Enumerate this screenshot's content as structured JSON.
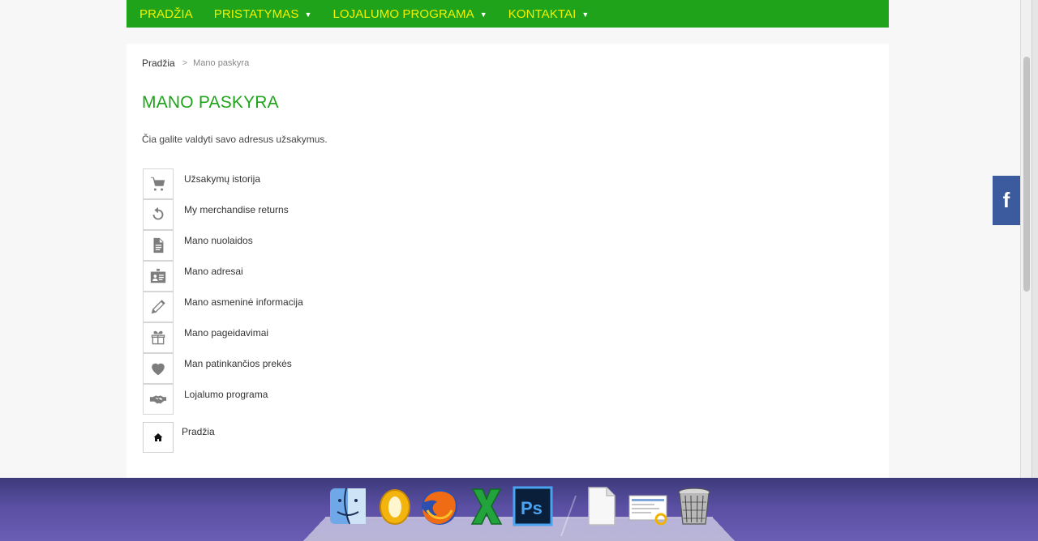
{
  "nav": {
    "items": [
      {
        "label": "PRADŽIA",
        "has_dropdown": false
      },
      {
        "label": "PRISTATYMAS",
        "has_dropdown": true
      },
      {
        "label": "LOJALUMO PROGRAMA",
        "has_dropdown": true
      },
      {
        "label": "KONTAKTAI",
        "has_dropdown": true
      }
    ],
    "bg_color": "#1ea31a",
    "text_color": "#f2f200"
  },
  "breadcrumb": {
    "home": "Pradžia",
    "separator": ">",
    "current": "Mano paskyra"
  },
  "page": {
    "title": "MANO PASKYRA",
    "intro": "Čia galite valdyti savo adresus užsakymus."
  },
  "account_links": [
    {
      "label": "Užsakymų istorija",
      "icon": "cart-icon"
    },
    {
      "label": "My merchandise returns",
      "icon": "refresh-icon"
    },
    {
      "label": "Mano nuolaidos",
      "icon": "document-icon"
    },
    {
      "label": "Mano adresai",
      "icon": "address-card-icon"
    },
    {
      "label": "Mano asmeninė informacija",
      "icon": "pencil-icon"
    },
    {
      "label": "Mano pageidavimai",
      "icon": "gift-icon"
    },
    {
      "label": "Man patinkančios prekės",
      "icon": "heart-icon"
    },
    {
      "label": "Lojalumo programa",
      "icon": "handshake-icon"
    }
  ],
  "home_link": {
    "label": "Pradžia",
    "icon": "home-icon"
  },
  "social": {
    "facebook_label": "f",
    "facebook_color": "#3b5b9e"
  },
  "dock": {
    "apps": [
      "finder-icon",
      "outlook-icon",
      "firefox-icon",
      "excel-icon",
      "photoshop-icon",
      "document-icon",
      "preview-icon",
      "trash-icon"
    ],
    "photoshop_label": "Ps"
  }
}
